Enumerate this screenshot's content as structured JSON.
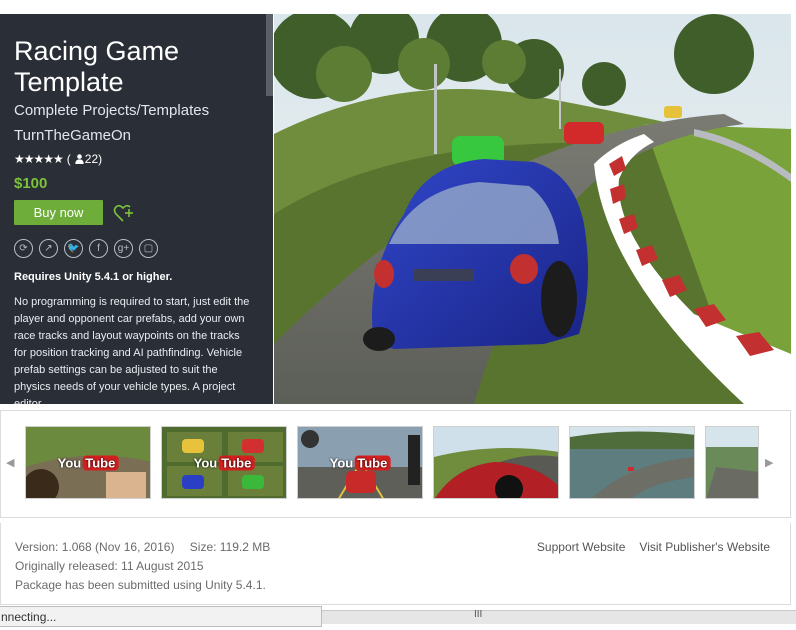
{
  "product": {
    "title": "Racing Game Template",
    "category": "Complete Projects/Templates",
    "publisher": "TurnTheGameOn",
    "stars": "★★★★★",
    "rating_count": "(",
    "rating_count_value": "22)",
    "price": "$100",
    "buy_label": "Buy now",
    "requires": "Requires Unity 5.4.1 or higher.",
    "description": "No programming is required to start, just edit the player and opponent car prefabs, add your own race tracks and layout waypoints on the tracks for position tracking and AI pathfinding. Vehicle prefab settings can be adjusted to suit the physics needs of your vehicle types. A project editor"
  },
  "share_icons": [
    "share-icon",
    "external-link-icon",
    "twitter-icon",
    "facebook-icon",
    "google-plus-icon",
    "embed-icon"
  ],
  "thumbnails": [
    {
      "has_video": true
    },
    {
      "has_video": true
    },
    {
      "has_video": true
    },
    {
      "has_video": false
    },
    {
      "has_video": false
    },
    {
      "has_video": false
    }
  ],
  "youtube": {
    "you": "You",
    "tube": "Tube"
  },
  "meta": {
    "version": "Version: 1.068 (Nov 16, 2016)",
    "size": "Size: 119.2 MB",
    "released": "Originally released: 11 August 2015",
    "submitted": "Package has been submitted using Unity 5.4.1.",
    "support_link": "Support Website",
    "publisher_link": "Visit Publisher's Website"
  },
  "status": {
    "text": "nnecting..."
  },
  "colors": {
    "panel_bg": "#2a2f37",
    "price": "#7cc23a",
    "buy_button": "#6fad3a"
  }
}
